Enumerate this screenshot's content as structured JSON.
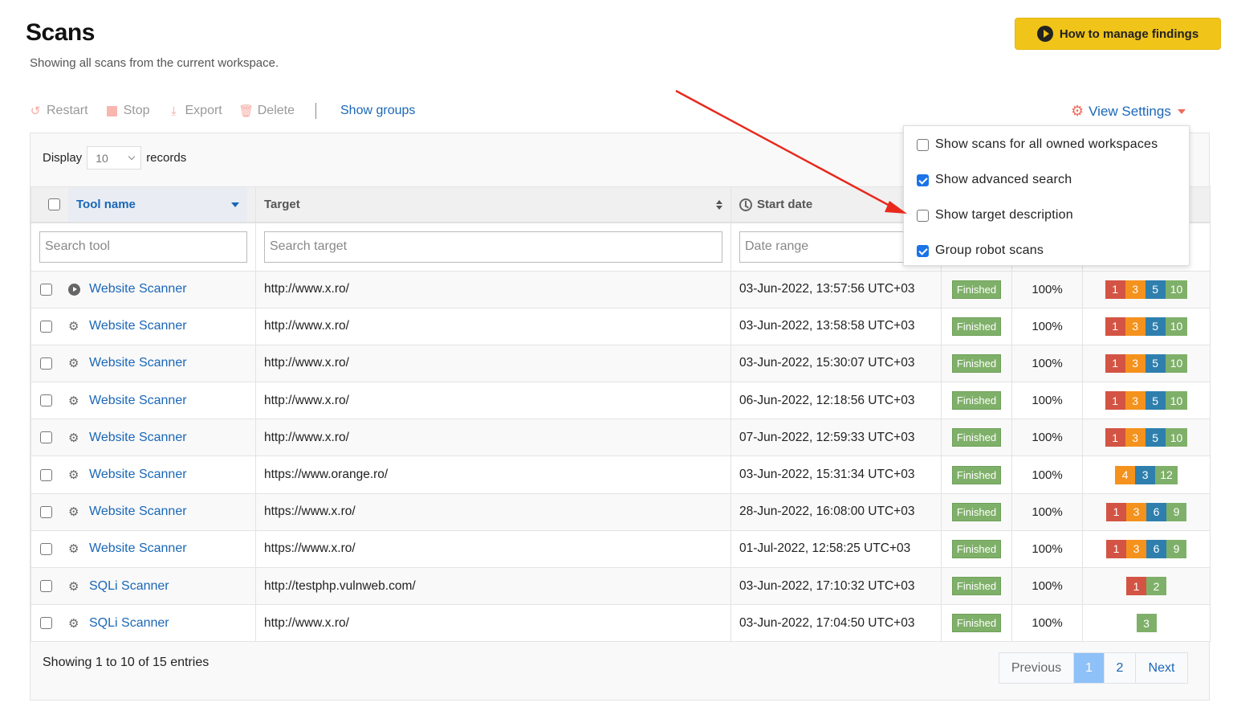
{
  "header": {
    "title": "Scans",
    "subtitle": "Showing all scans from the current workspace.",
    "help_button": "How to manage findings"
  },
  "toolbar": {
    "restart": "Restart",
    "stop": "Stop",
    "export": "Export",
    "delete": "Delete",
    "show_groups": "Show groups",
    "view_settings": "View Settings"
  },
  "view_settings_menu": [
    {
      "label": "Show scans for all owned workspaces",
      "checked": false
    },
    {
      "label": "Show advanced search",
      "checked": true
    },
    {
      "label": "Show target description",
      "checked": false
    },
    {
      "label": "Group robot scans",
      "checked": true
    }
  ],
  "display": {
    "prefix": "Display",
    "value": "10",
    "suffix": "records"
  },
  "columns": {
    "tool": "Tool name",
    "target": "Target",
    "start_date": "Start date"
  },
  "search": {
    "tool_placeholder": "Search tool",
    "target_placeholder": "Search target",
    "date_placeholder": "Date range"
  },
  "rows": [
    {
      "icon": "play",
      "tool": "Website Scanner",
      "target": "http://www.x.ro/",
      "date": "03-Jun-2022, 13:57:56 UTC+03",
      "status": "Finished",
      "progress": "100%",
      "findings": {
        "critical": 1,
        "high": 3,
        "medium": 5,
        "low": 10
      }
    },
    {
      "icon": "gear",
      "tool": "Website Scanner",
      "target": "http://www.x.ro/",
      "date": "03-Jun-2022, 13:58:58 UTC+03",
      "status": "Finished",
      "progress": "100%",
      "findings": {
        "critical": 1,
        "high": 3,
        "medium": 5,
        "low": 10
      }
    },
    {
      "icon": "gear",
      "tool": "Website Scanner",
      "target": "http://www.x.ro/",
      "date": "03-Jun-2022, 15:30:07 UTC+03",
      "status": "Finished",
      "progress": "100%",
      "findings": {
        "critical": 1,
        "high": 3,
        "medium": 5,
        "low": 10
      }
    },
    {
      "icon": "gear",
      "tool": "Website Scanner",
      "target": "http://www.x.ro/",
      "date": "06-Jun-2022, 12:18:56 UTC+03",
      "status": "Finished",
      "progress": "100%",
      "findings": {
        "critical": 1,
        "high": 3,
        "medium": 5,
        "low": 10
      }
    },
    {
      "icon": "gear",
      "tool": "Website Scanner",
      "target": "http://www.x.ro/",
      "date": "07-Jun-2022, 12:59:33 UTC+03",
      "status": "Finished",
      "progress": "100%",
      "findings": {
        "critical": 1,
        "high": 3,
        "medium": 5,
        "low": 10
      }
    },
    {
      "icon": "gear",
      "tool": "Website Scanner",
      "target": "https://www.orange.ro/",
      "date": "03-Jun-2022, 15:31:34 UTC+03",
      "status": "Finished",
      "progress": "100%",
      "findings": {
        "critical": 0,
        "high": 4,
        "medium": 3,
        "low": 12
      }
    },
    {
      "icon": "gear",
      "tool": "Website Scanner",
      "target": "https://www.x.ro/",
      "date": "28-Jun-2022, 16:08:00 UTC+03",
      "status": "Finished",
      "progress": "100%",
      "findings": {
        "critical": 1,
        "high": 3,
        "medium": 6,
        "low": 9
      }
    },
    {
      "icon": "gear",
      "tool": "Website Scanner",
      "target": "https://www.x.ro/",
      "date": "01-Jul-2022, 12:58:25 UTC+03",
      "status": "Finished",
      "progress": "100%",
      "findings": {
        "critical": 1,
        "high": 3,
        "medium": 6,
        "low": 9
      }
    },
    {
      "icon": "gear",
      "tool": "SQLi Scanner",
      "target": "http://testphp.vulnweb.com/",
      "date": "03-Jun-2022, 17:10:32 UTC+03",
      "status": "Finished",
      "progress": "100%",
      "findings": {
        "critical": 1,
        "high": 0,
        "medium": 0,
        "low": 2
      }
    },
    {
      "icon": "gear",
      "tool": "SQLi Scanner",
      "target": "http://www.x.ro/",
      "date": "03-Jun-2022, 17:04:50 UTC+03",
      "status": "Finished",
      "progress": "100%",
      "findings": {
        "critical": 0,
        "high": 0,
        "medium": 0,
        "low": 3
      }
    }
  ],
  "footer": {
    "info": "Showing 1 to 10 of 15 entries",
    "previous": "Previous",
    "pages": [
      "1",
      "2"
    ],
    "current_page": "1",
    "next": "Next"
  },
  "colors": {
    "accent": "#1a67b7",
    "help_button": "#f0c419",
    "critical": "#d35444",
    "high": "#f4921d",
    "medium": "#2e7fad",
    "low": "#7fb069",
    "annotation_arrow": "#e8291c"
  }
}
